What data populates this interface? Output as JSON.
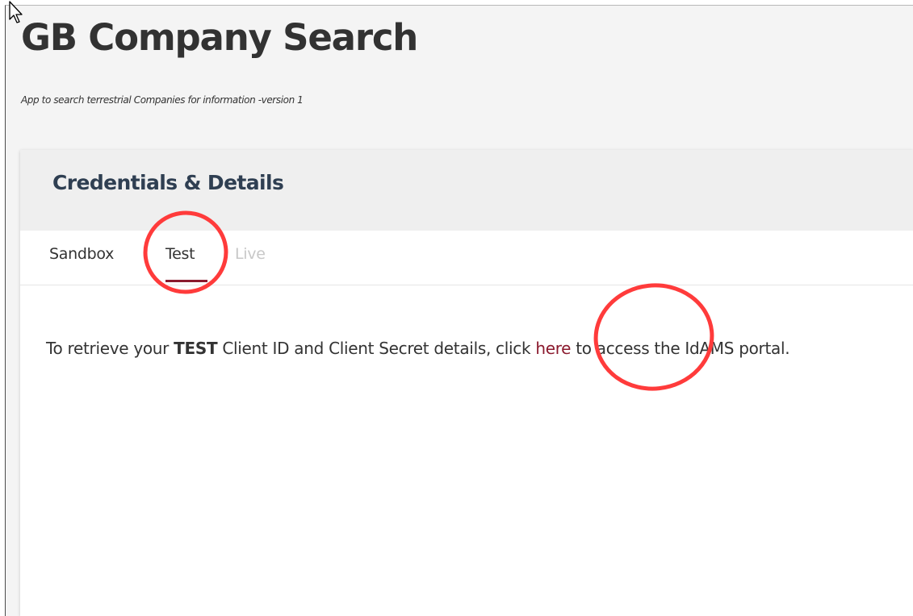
{
  "app": {
    "title": "GB Company Search",
    "subtitle": "App to search terrestrial Companies for information -version 1"
  },
  "card": {
    "title": "Credentials & Details",
    "tabs": [
      {
        "label": "Sandbox",
        "state": "inactive"
      },
      {
        "label": "Test",
        "state": "active"
      },
      {
        "label": "Live",
        "state": "disabled"
      }
    ],
    "content": {
      "prefix": "To retrieve your ",
      "env": "TEST",
      "middle": " Client ID and Client Secret details, click ",
      "link_label": "here",
      "suffix": " to access the IdAMS portal."
    }
  },
  "colors": {
    "accent": "#8b1a2e",
    "annotation": "#ff3b3b",
    "disabled_tab": "#c8c8c8"
  },
  "icons": {
    "cursor": "mouse-pointer-icon"
  }
}
